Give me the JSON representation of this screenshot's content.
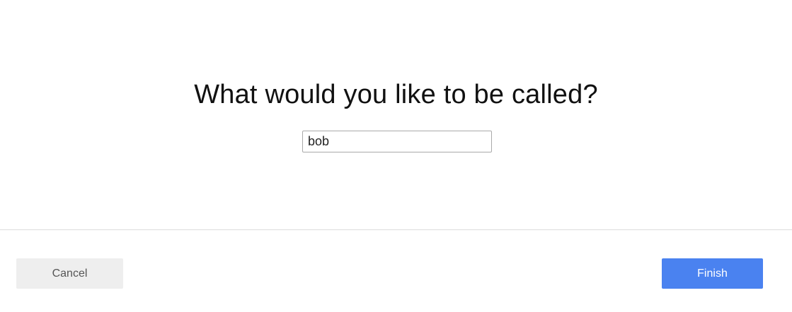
{
  "dialog": {
    "question": "What would you like to be called?",
    "name_input": {
      "value": "bob",
      "placeholder": ""
    }
  },
  "footer": {
    "cancel_label": "Cancel",
    "finish_label": "Finish"
  },
  "colors": {
    "finish_button": "#4a82f0",
    "cancel_button": "#eeeeee",
    "divider": "#dcdcdc"
  }
}
